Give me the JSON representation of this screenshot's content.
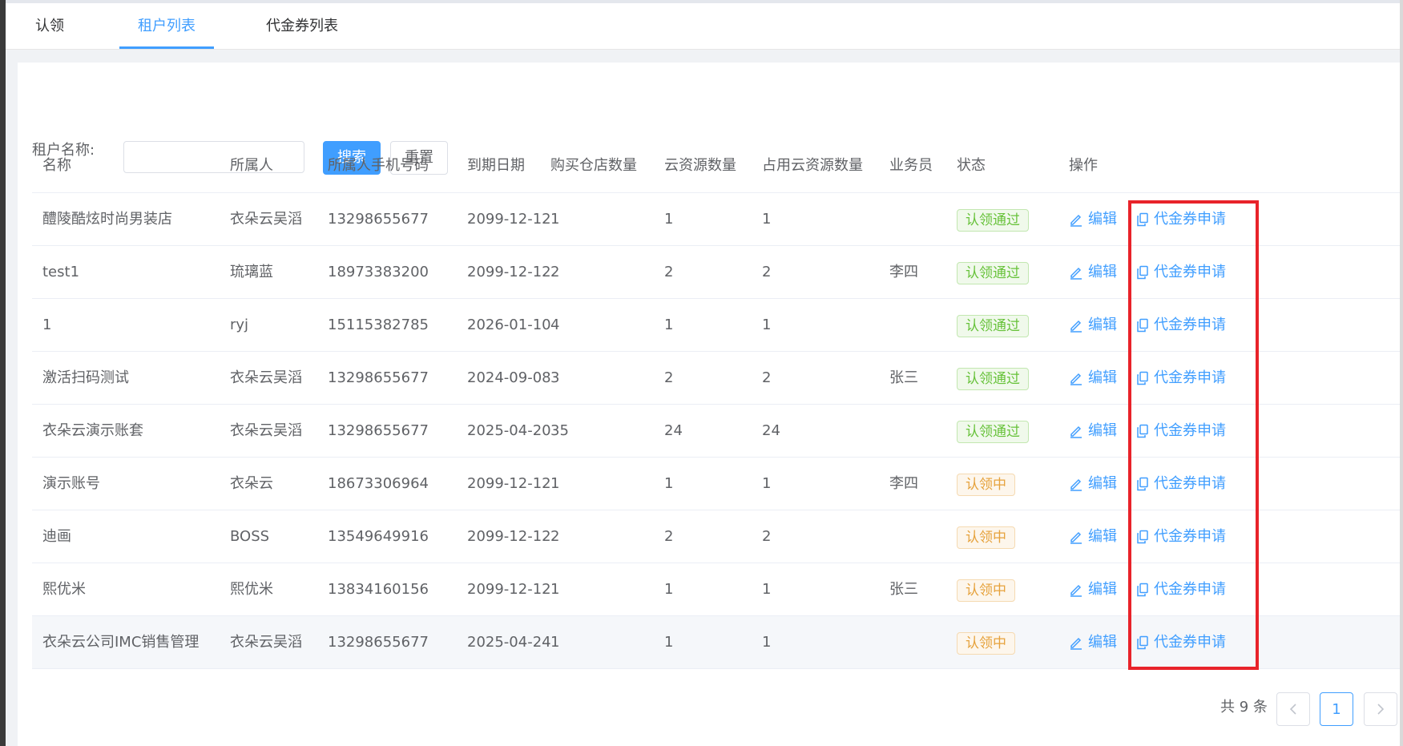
{
  "tabs": [
    {
      "label": "认领"
    },
    {
      "label": "租户列表"
    },
    {
      "label": "代金券列表"
    }
  ],
  "search": {
    "label": "租户名称:",
    "input_value": "",
    "search_button": "搜索",
    "reset_button": "重置"
  },
  "table": {
    "headers": [
      "名称",
      "所属人",
      "所属人手机号码",
      "到期日期",
      "购买仓店数量",
      "云资源数量",
      "占用云资源数量",
      "业务员",
      "状态",
      "操作"
    ],
    "actions": {
      "edit": "编辑",
      "voucher": "代金券申请"
    },
    "rows": [
      {
        "name": "醴陵酷炫时尚男装店",
        "owner": "衣朵云吴滔",
        "phone": "13298655677",
        "expire": "2099-12-12",
        "stores": "1",
        "cloud": "1",
        "used": "1",
        "salesman": "",
        "status": "认领通过",
        "status_type": "success"
      },
      {
        "name": "test1",
        "owner": "琉璃蓝",
        "phone": "18973383200",
        "expire": "2099-12-12",
        "stores": "2",
        "cloud": "2",
        "used": "2",
        "salesman": "李四",
        "status": "认领通过",
        "status_type": "success"
      },
      {
        "name": "1",
        "owner": "ryj",
        "phone": "15115382785",
        "expire": "2026-01-10",
        "stores": "4",
        "cloud": "1",
        "used": "1",
        "salesman": "",
        "status": "认领通过",
        "status_type": "success"
      },
      {
        "name": "激活扫码测试",
        "owner": "衣朵云吴滔",
        "phone": "13298655677",
        "expire": "2024-09-08",
        "stores": "3",
        "cloud": "2",
        "used": "2",
        "salesman": "张三",
        "status": "认领通过",
        "status_type": "success"
      },
      {
        "name": "衣朵云演示账套",
        "owner": "衣朵云吴滔",
        "phone": "13298655677",
        "expire": "2025-04-20",
        "stores": "35",
        "cloud": "24",
        "used": "24",
        "salesman": "",
        "status": "认领通过",
        "status_type": "success"
      },
      {
        "name": "演示账号",
        "owner": "衣朵云",
        "phone": "18673306964",
        "expire": "2099-12-12",
        "stores": "1",
        "cloud": "1",
        "used": "1",
        "salesman": "李四",
        "status": "认领中",
        "status_type": "warning"
      },
      {
        "name": "迪画",
        "owner": "BOSS",
        "phone": "13549649916",
        "expire": "2099-12-12",
        "stores": "2",
        "cloud": "2",
        "used": "2",
        "salesman": "",
        "status": "认领中",
        "status_type": "warning"
      },
      {
        "name": "熙优米",
        "owner": "熙优米",
        "phone": "13834160156",
        "expire": "2099-12-12",
        "stores": "1",
        "cloud": "1",
        "used": "1",
        "salesman": "张三",
        "status": "认领中",
        "status_type": "warning"
      },
      {
        "name": "衣朵云公司IMC销售管理",
        "owner": "衣朵云吴滔",
        "phone": "13298655677",
        "expire": "2025-04-24",
        "stores": "1",
        "cloud": "1",
        "used": "1",
        "salesman": "",
        "status": "认领中",
        "status_type": "warning"
      }
    ]
  },
  "pagination": {
    "total_text": "共 9 条",
    "current_page": "1"
  },
  "colors": {
    "primary": "#409eff",
    "success": "#67c23a",
    "warning": "#e6a23c",
    "highlight_box": "#e8232a"
  }
}
